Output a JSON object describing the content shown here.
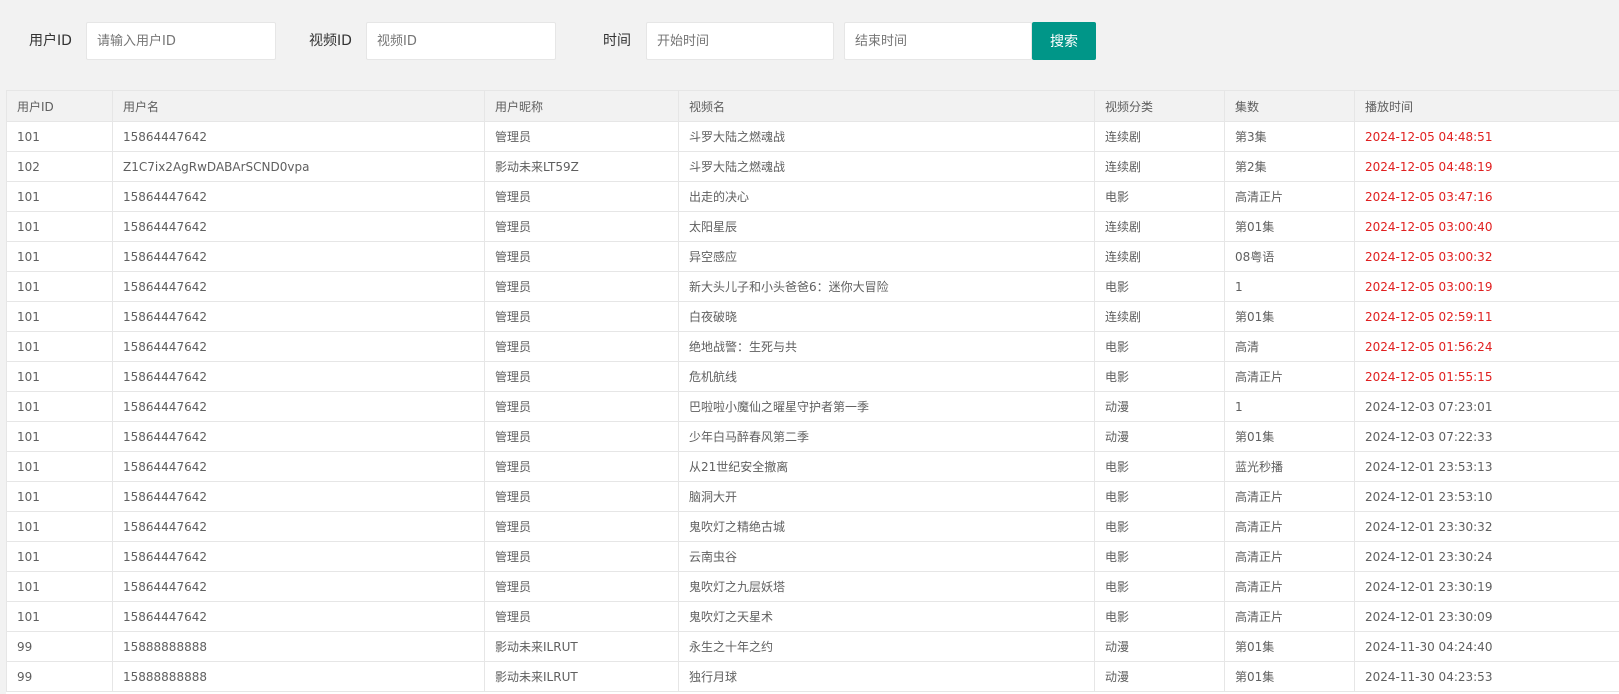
{
  "filters": {
    "user_id_label": "用户ID",
    "user_id_placeholder": "请输入用户ID",
    "video_id_label": "视频ID",
    "video_id_placeholder": "视频ID",
    "time_label": "时间",
    "start_placeholder": "开始时间",
    "end_placeholder": "结束时间",
    "search_label": "搜索"
  },
  "colors": {
    "accent": "#009688",
    "highlight_time": "#e02020"
  },
  "table": {
    "headers": [
      "用户ID",
      "用户名",
      "用户昵称",
      "视频名",
      "视频分类",
      "集数",
      "播放时间"
    ],
    "rows": [
      [
        "101",
        "15864447642",
        "管理员",
        "斗罗大陆之燃魂战",
        "连续剧",
        "第3集",
        "2024-12-05 04:48:51",
        true
      ],
      [
        "102",
        "Z1C7ix2AgRwDABArSCND0vpa",
        "影动未来LT59Z",
        "斗罗大陆之燃魂战",
        "连续剧",
        "第2集",
        "2024-12-05 04:48:19",
        true
      ],
      [
        "101",
        "15864447642",
        "管理员",
        "出走的决心",
        "电影",
        "高清正片",
        "2024-12-05 03:47:16",
        true
      ],
      [
        "101",
        "15864447642",
        "管理员",
        "太阳星辰",
        "连续剧",
        "第01集",
        "2024-12-05 03:00:40",
        true
      ],
      [
        "101",
        "15864447642",
        "管理员",
        "异空感应",
        "连续剧",
        "08粤语",
        "2024-12-05 03:00:32",
        true
      ],
      [
        "101",
        "15864447642",
        "管理员",
        "新大头儿子和小头爸爸6：迷你大冒险",
        "电影",
        "1",
        "2024-12-05 03:00:19",
        true
      ],
      [
        "101",
        "15864447642",
        "管理员",
        "白夜破晓",
        "连续剧",
        "第01集",
        "2024-12-05 02:59:11",
        true
      ],
      [
        "101",
        "15864447642",
        "管理员",
        "绝地战警：生死与共",
        "电影",
        "高清",
        "2024-12-05 01:56:24",
        true
      ],
      [
        "101",
        "15864447642",
        "管理员",
        "危机航线",
        "电影",
        "高清正片",
        "2024-12-05 01:55:15",
        true
      ],
      [
        "101",
        "15864447642",
        "管理员",
        "巴啦啦小魔仙之曜星守护者第一季",
        "动漫",
        "1",
        "2024-12-03 07:23:01",
        false
      ],
      [
        "101",
        "15864447642",
        "管理员",
        "少年白马醉春风第二季",
        "动漫",
        "第01集",
        "2024-12-03 07:22:33",
        false
      ],
      [
        "101",
        "15864447642",
        "管理员",
        "从21世纪安全撤离",
        "电影",
        "蓝光秒播",
        "2024-12-01 23:53:13",
        false
      ],
      [
        "101",
        "15864447642",
        "管理员",
        "脑洞大开",
        "电影",
        "高清正片",
        "2024-12-01 23:53:10",
        false
      ],
      [
        "101",
        "15864447642",
        "管理员",
        "鬼吹灯之精绝古城",
        "电影",
        "高清正片",
        "2024-12-01 23:30:32",
        false
      ],
      [
        "101",
        "15864447642",
        "管理员",
        "云南虫谷",
        "电影",
        "高清正片",
        "2024-12-01 23:30:24",
        false
      ],
      [
        "101",
        "15864447642",
        "管理员",
        "鬼吹灯之九层妖塔",
        "电影",
        "高清正片",
        "2024-12-01 23:30:19",
        false
      ],
      [
        "101",
        "15864447642",
        "管理员",
        "鬼吹灯之天星术",
        "电影",
        "高清正片",
        "2024-12-01 23:30:09",
        false
      ],
      [
        "99",
        "15888888888",
        "影动未来ILRUT",
        "永生之十年之约",
        "动漫",
        "第01集",
        "2024-11-30 04:24:40",
        false
      ],
      [
        "99",
        "15888888888",
        "影动未来ILRUT",
        "独行月球",
        "动漫",
        "第01集",
        "2024-11-30 04:23:53",
        false
      ]
    ]
  }
}
